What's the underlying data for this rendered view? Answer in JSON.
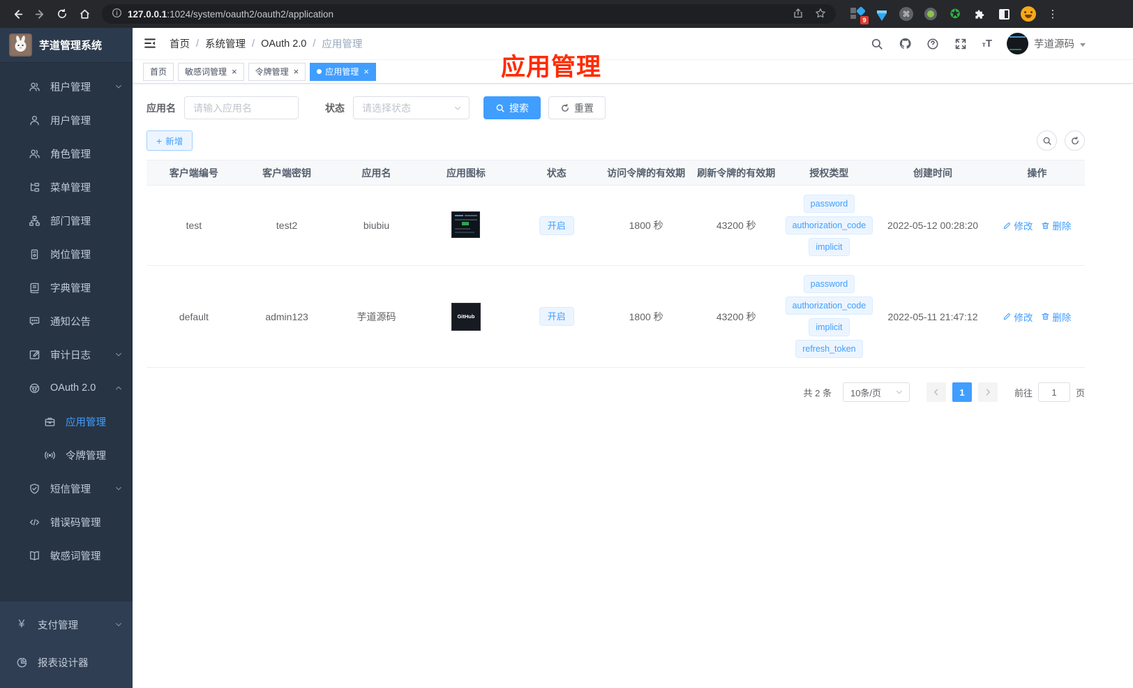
{
  "theme": {
    "accent": "#409eff",
    "sidebar_bg": "#273444",
    "annotation_red": "#ff2b00",
    "tag_bg": "#ecf5ff",
    "tag_border": "#d9ecff"
  },
  "browser": {
    "url_host": "127.0.0.1",
    "url_rest": ":1024/system/oauth2/oauth2/application",
    "extension_badge": "9"
  },
  "sidebar": {
    "logo_title": "芋道管理系统",
    "main_items": [
      {
        "label": "租户管理",
        "icon": "tenant-users",
        "chevron": "down"
      },
      {
        "label": "用户管理",
        "icon": "user"
      },
      {
        "label": "角色管理",
        "icon": "role-users"
      },
      {
        "label": "菜单管理",
        "icon": "menu-list"
      },
      {
        "label": "部门管理",
        "icon": "org-tree"
      },
      {
        "label": "岗位管理",
        "icon": "post-badge"
      },
      {
        "label": "字典管理",
        "icon": "dictionary-book"
      },
      {
        "label": "通知公告",
        "icon": "announcement-chat"
      },
      {
        "label": "审计日志",
        "icon": "audit-log",
        "chevron": "down"
      },
      {
        "label": "OAuth 2.0",
        "icon": "oauth-robot",
        "chevron": "up",
        "children": [
          {
            "label": "应用管理",
            "icon": "app-briefcase",
            "active": true
          },
          {
            "label": "令牌管理",
            "icon": "token-signal"
          }
        ]
      },
      {
        "label": "短信管理",
        "icon": "sms-shield",
        "chevron": "down"
      },
      {
        "label": "错误码管理",
        "icon": "error-code"
      },
      {
        "label": "敏感词管理",
        "icon": "sensitive-book"
      }
    ],
    "bottom_items": [
      {
        "label": "支付管理",
        "icon": "yen",
        "chevron": "down"
      },
      {
        "label": "报表设计器",
        "icon": "report-pie"
      }
    ]
  },
  "navbar": {
    "breadcrumbs": [
      "首页",
      "系统管理",
      "OAuth 2.0",
      "应用管理"
    ],
    "username": "芋道源码"
  },
  "tabs": [
    {
      "label": "首页",
      "closable": false,
      "active": false
    },
    {
      "label": "敏感词管理",
      "closable": true,
      "active": false
    },
    {
      "label": "令牌管理",
      "closable": true,
      "active": false
    },
    {
      "label": "应用管理",
      "closable": true,
      "active": true
    }
  ],
  "annotation": {
    "text": "应用管理"
  },
  "filters": {
    "name_label": "应用名",
    "name_placeholder": "请输入应用名",
    "status_label": "状态",
    "status_placeholder": "请选择状态",
    "search_label": "搜索",
    "reset_label": "重置",
    "add_label": "新增"
  },
  "table": {
    "headers": [
      "客户端编号",
      "客户端密钥",
      "应用名",
      "应用图标",
      "状态",
      "访问令牌的有效期",
      "刷新令牌的有效期",
      "授权类型",
      "创建时间",
      "操作"
    ],
    "edit_label": "修改",
    "delete_label": "删除",
    "rows": [
      {
        "client_id": "test",
        "client_secret": "test2",
        "app_name": "biubiu",
        "icon_type": "dashboard-screenshot",
        "icon_text": "",
        "status": "开启",
        "access_token_ttl": "1800 秒",
        "refresh_token_ttl": "43200 秒",
        "grant_types": [
          "password",
          "authorization_code",
          "implicit"
        ],
        "created_at": "2022-05-12 00:28:20"
      },
      {
        "client_id": "default",
        "client_secret": "admin123",
        "app_name": "芋道源码",
        "icon_type": "github-dark",
        "icon_text": "GitHub",
        "status": "开启",
        "access_token_ttl": "1800 秒",
        "refresh_token_ttl": "43200 秒",
        "grant_types": [
          "password",
          "authorization_code",
          "implicit",
          "refresh_token"
        ],
        "created_at": "2022-05-11 21:47:12"
      }
    ]
  },
  "pagination": {
    "total_text": "共 2 条",
    "page_size": "10条/页",
    "current_page": "1",
    "goto_label": "前往",
    "goto_value": "1",
    "unit_label": "页"
  }
}
